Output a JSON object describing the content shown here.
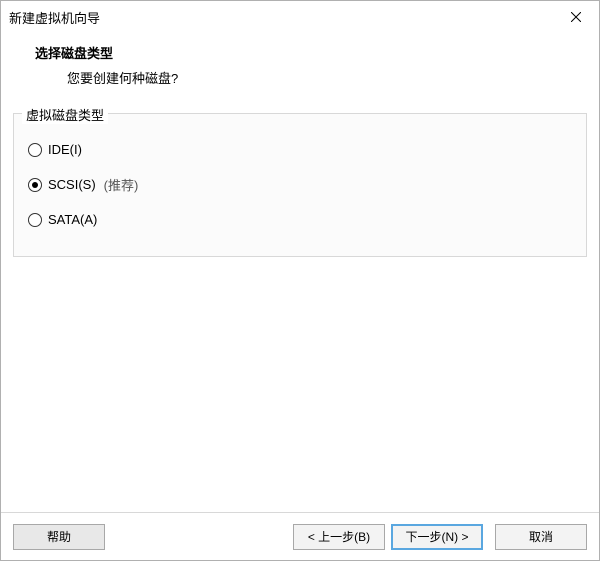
{
  "window": {
    "title": "新建虚拟机向导"
  },
  "header": {
    "title": "选择磁盘类型",
    "subtitle": "您要创建何种磁盘?"
  },
  "group": {
    "legend": "虚拟磁盘类型",
    "options": [
      {
        "label": "IDE(I)",
        "hint": "",
        "selected": false
      },
      {
        "label": "SCSI(S)",
        "hint": "(推荐)",
        "selected": true
      },
      {
        "label": "SATA(A)",
        "hint": "",
        "selected": false
      }
    ]
  },
  "footer": {
    "help": "帮助",
    "back": "< 上一步(B)",
    "next": "下一步(N) >",
    "cancel": "取消"
  }
}
